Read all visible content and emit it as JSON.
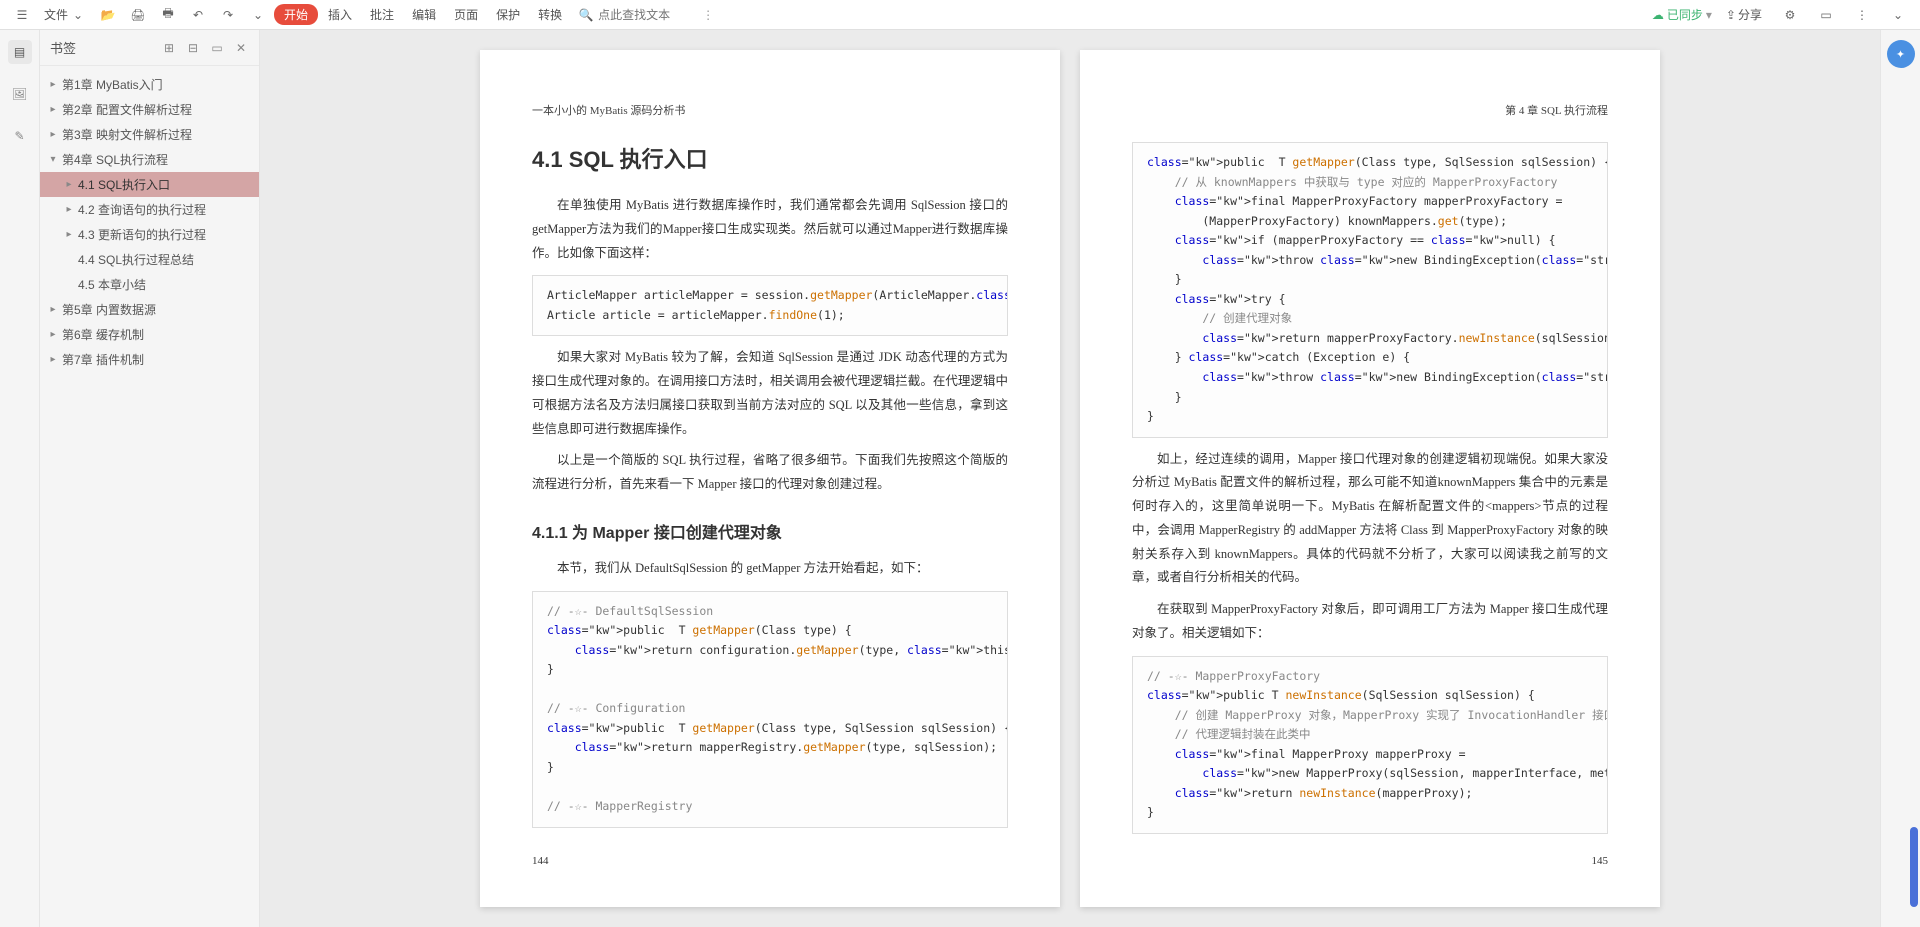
{
  "toolbar": {
    "file_label": "文件",
    "icons": [
      "folder-icon",
      "save-icon",
      "print-icon",
      "undo-icon",
      "redo-icon",
      "redo-down-icon"
    ],
    "start_label": "开始",
    "menu": [
      "插入",
      "批注",
      "编辑",
      "页面",
      "保护",
      "转换"
    ],
    "search_placeholder": "点此查找文本",
    "sync_label": "已同步",
    "share_label": "分享"
  },
  "bookmarks": {
    "title": "书签",
    "items": [
      {
        "label": "第1章 MyBatis入门",
        "expandable": true,
        "level": 0
      },
      {
        "label": "第2章 配置文件解析过程",
        "expandable": true,
        "level": 0
      },
      {
        "label": "第3章 映射文件解析过程",
        "expandable": true,
        "level": 0
      },
      {
        "label": "第4章 SQL执行流程",
        "expandable": true,
        "level": 0,
        "expanded": true
      },
      {
        "label": "4.1 SQL执行入口",
        "expandable": true,
        "level": 1,
        "selected": true
      },
      {
        "label": "4.2 查询语句的执行过程",
        "expandable": true,
        "level": 1
      },
      {
        "label": "4.3 更新语句的执行过程",
        "expandable": true,
        "level": 1
      },
      {
        "label": "4.4 SQL执行过程总结",
        "expandable": false,
        "level": 1
      },
      {
        "label": "4.5 本章小结",
        "expandable": false,
        "level": 1
      },
      {
        "label": "第5章 内置数据源",
        "expandable": true,
        "level": 0
      },
      {
        "label": "第6章 缓存机制",
        "expandable": true,
        "level": 0
      },
      {
        "label": "第7章 插件机制",
        "expandable": true,
        "level": 0
      }
    ]
  },
  "doc": {
    "leftPage": {
      "header": "一本小小的 MyBatis 源码分析书",
      "h1": "4.1 SQL 执行入口",
      "p1": "在单独使用 MyBatis 进行数据库操作时，我们通常都会先调用 SqlSession 接口的 getMapper方法为我们的Mapper接口生成实现类。然后就可以通过Mapper进行数据库操作。比如像下面这样：",
      "code1_l1_a": "ArticleMapper articleMapper = session.",
      "code1_l1_b": "getMapper",
      "code1_l1_c": "(ArticleMapper.",
      "code1_l1_d": "class",
      "code1_l1_e": ");",
      "code1_l2_a": "Article article = articleMapper.",
      "code1_l2_b": "findOne",
      "code1_l2_c": "(1);",
      "p2": "如果大家对 MyBatis 较为了解，会知道 SqlSession 是通过 JDK 动态代理的方式为接口生成代理对象的。在调用接口方法时，相关调用会被代理逻辑拦截。在代理逻辑中可根据方法名及方法归属接口获取到当前方法对应的 SQL 以及其他一些信息，拿到这些信息即可进行数据库操作。",
      "p3": "以上是一个简版的 SQL 执行过程，省略了很多细节。下面我们先按照这个简版的流程进行分析，首先来看一下 Mapper 接口的代理对象创建过程。",
      "h2": "4.1.1 为 Mapper 接口创建代理对象",
      "p4": "本节，我们从 DefaultSqlSession 的 getMapper 方法开始看起，如下：",
      "code2": "// -☆- DefaultSqlSession\npublic <T> T getMapper(Class<T> type) {\n    return configuration.<T>getMapper(type, this);\n}\n\n// -☆- Configuration\npublic <T> T getMapper(Class<T> type, SqlSession sqlSession) {\n    return mapperRegistry.getMapper(type, sqlSession);\n}\n\n// -☆- MapperRegistry",
      "pageNum": "144"
    },
    "rightPage": {
      "header": "第 4 章 SQL 执行流程",
      "code1": "public <T> T getMapper(Class<T> type, SqlSession sqlSession) {\n    // 从 knownMappers 中获取与 type 对应的 MapperProxyFactory\n    final MapperProxyFactory<T> mapperProxyFactory =\n        (MapperProxyFactory<T>) knownMappers.get(type);\n    if (mapperProxyFactory == null) {\n        throw new BindingException(\"……\");\n    }\n    try {\n        // 创建代理对象\n        return mapperProxyFactory.newInstance(sqlSession);\n    } catch (Exception e) {\n        throw new BindingException(\"……\");\n    }\n}",
      "p1": "如上，经过连续的调用，Mapper 接口代理对象的创建逻辑初现端倪。如果大家没分析过 MyBatis 配置文件的解析过程，那么可能不知道knownMappers 集合中的元素是何时存入的，这里简单说明一下。MyBatis 在解析配置文件的<mappers>节点的过程中，会调用 MapperRegistry 的 addMapper 方法将 Class 到 MapperProxyFactory 对象的映射关系存入到 knownMappers。具体的代码就不分析了，大家可以阅读我之前写的文章，或者自行分析相关的代码。",
      "p2": "在获取到 MapperProxyFactory 对象后，即可调用工厂方法为 Mapper 接口生成代理对象了。相关逻辑如下：",
      "code2": "// -☆- MapperProxyFactory\npublic T newInstance(SqlSession sqlSession) {\n    // 创建 MapperProxy 对象，MapperProxy 实现了 InvocationHandler 接口，\n    // 代理逻辑封装在此类中\n    final MapperProxy<T> mapperProxy =\n        new MapperProxy<T>(sqlSession, mapperInterface, methodCache);\n    return newInstance(mapperProxy);\n}",
      "pageNum": "145"
    }
  }
}
